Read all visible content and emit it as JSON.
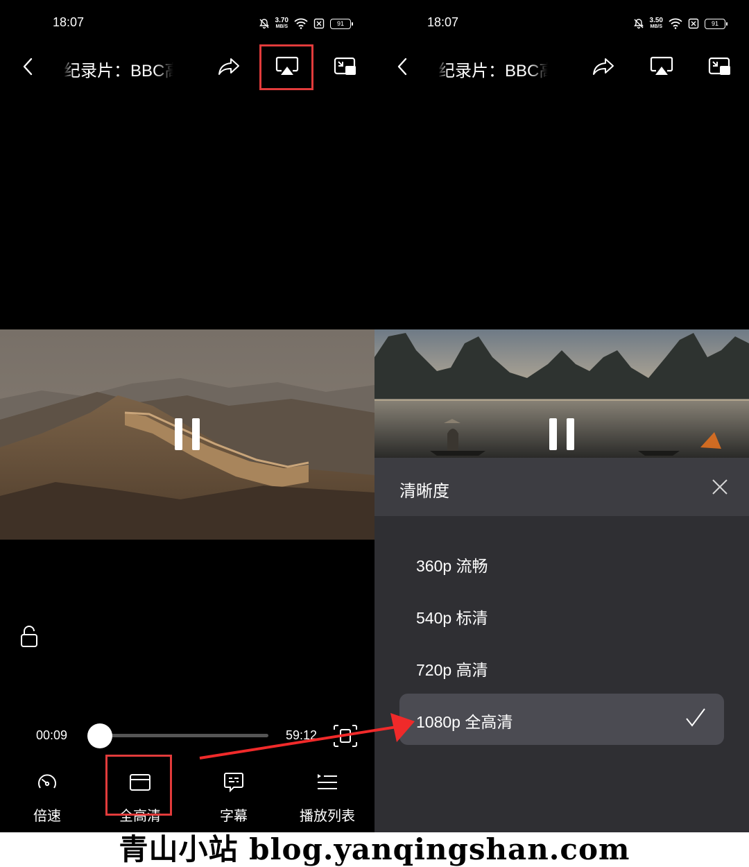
{
  "left_screen": {
    "status": {
      "time": "18:07",
      "net_speed": "3.70",
      "net_unit": "MB/S",
      "battery": "91"
    },
    "title": "纪录片：BBC高清",
    "time_current": "00:09",
    "time_total": "59:12",
    "progress_fraction": 0.003,
    "tools": [
      {
        "label": "倍速",
        "icon": "speedometer-icon"
      },
      {
        "label": "全高清",
        "icon": "display-icon"
      },
      {
        "label": "字幕",
        "icon": "subtitle-icon"
      },
      {
        "label": "播放列表",
        "icon": "playlist-icon"
      }
    ]
  },
  "right_screen": {
    "status": {
      "time": "18:07",
      "net_speed": "3.50",
      "net_unit": "MB/S",
      "battery": "91"
    },
    "title": "纪录片：BBC高清",
    "quality_panel": {
      "title": "清晰度",
      "options": [
        {
          "label": "360p 流畅",
          "selected": false
        },
        {
          "label": "540p 标清",
          "selected": false
        },
        {
          "label": "720p 高清",
          "selected": false
        },
        {
          "label": "1080p 全高清",
          "selected": true
        }
      ]
    }
  },
  "watermark": "青山小站 blog.yanqingshan.com",
  "colors": {
    "highlight": "#e23b3b",
    "panel": "#2f2f33",
    "panel_header": "#3d3d42",
    "selected_row": "#4b4b52"
  }
}
